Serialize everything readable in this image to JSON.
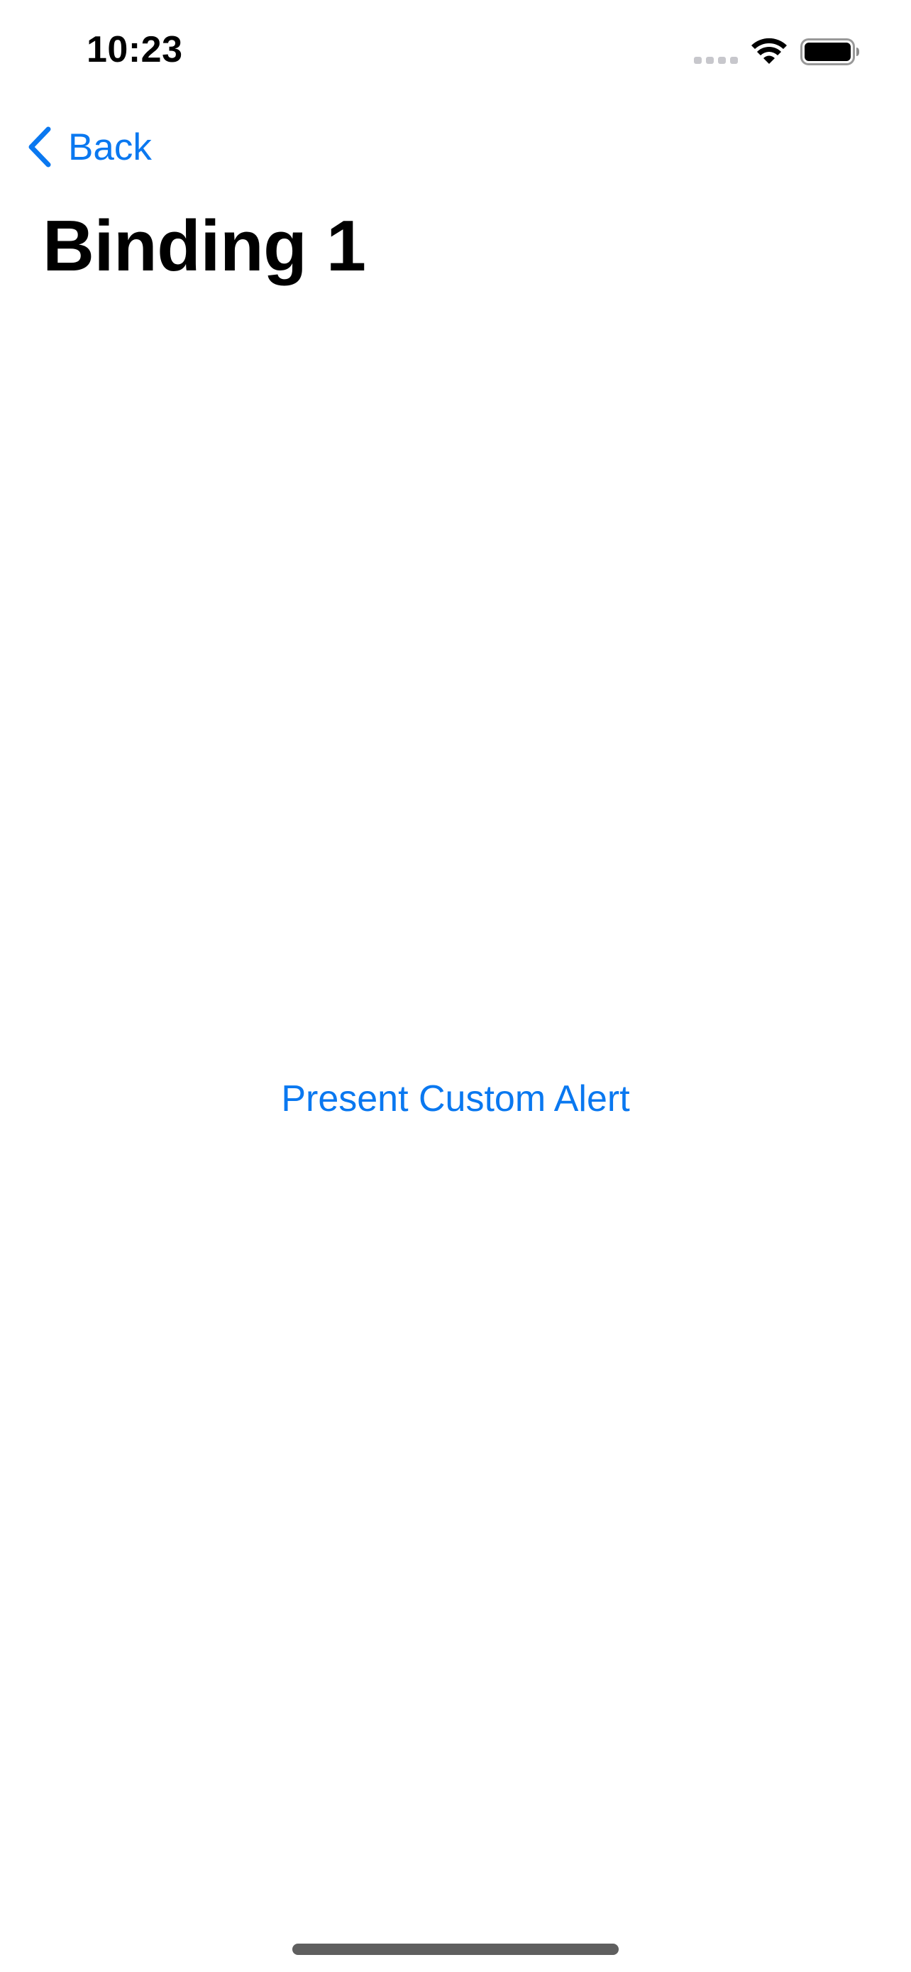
{
  "status_bar": {
    "time": "10:23",
    "icons": [
      "cellular-signal-icon",
      "wifi-icon",
      "battery-icon"
    ]
  },
  "nav": {
    "back_label": "Back",
    "back_icon": "chevron-left-icon",
    "title": "Binding 1"
  },
  "main": {
    "present_button_label": "Present Custom Alert"
  },
  "colors": {
    "accent": "#0a78f0",
    "text": "#000000",
    "background": "#ffffff",
    "home_indicator": "#5f5f5f"
  }
}
